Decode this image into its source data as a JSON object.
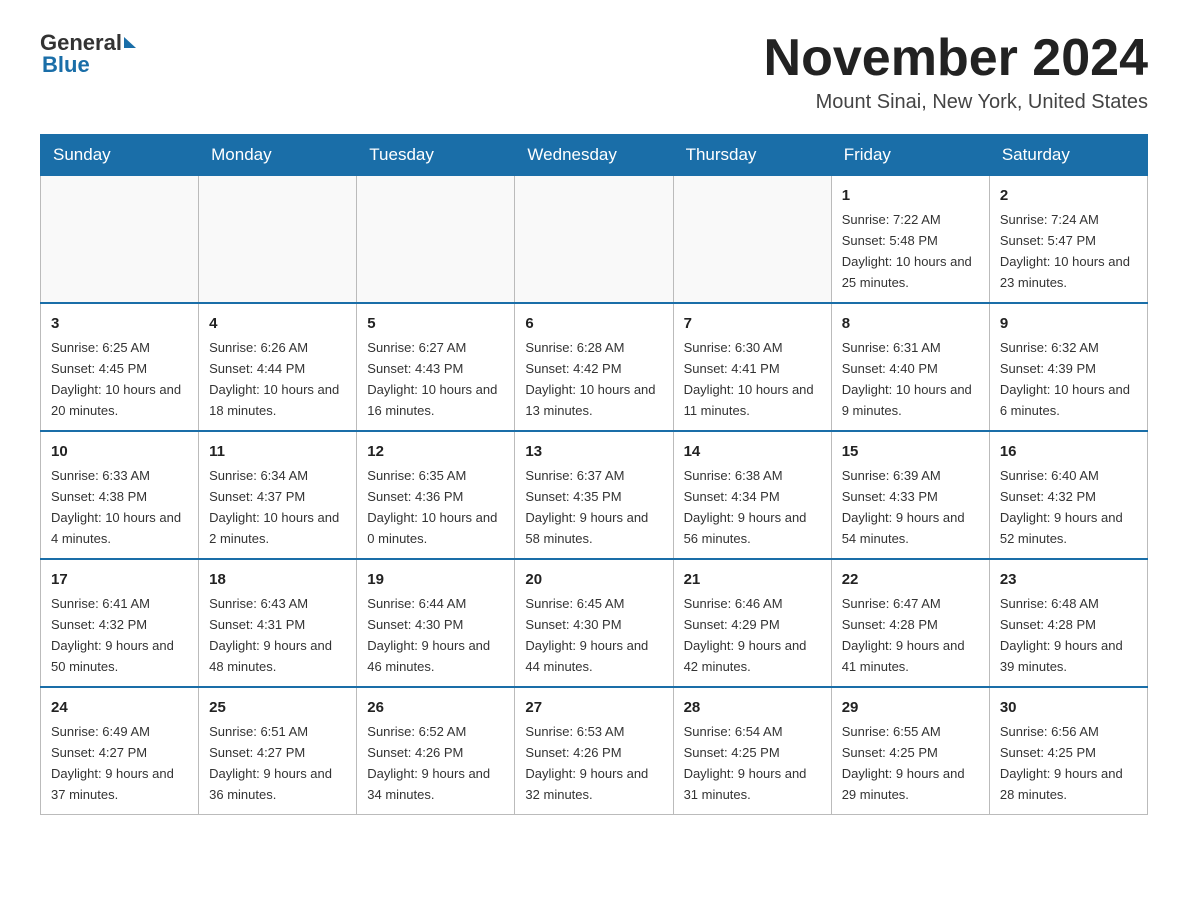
{
  "header": {
    "logo_general": "General",
    "logo_blue": "Blue",
    "month_title": "November 2024",
    "location": "Mount Sinai, New York, United States"
  },
  "weekdays": [
    "Sunday",
    "Monday",
    "Tuesday",
    "Wednesday",
    "Thursday",
    "Friday",
    "Saturday"
  ],
  "weeks": [
    [
      {
        "day": "",
        "sunrise": "",
        "sunset": "",
        "daylight": ""
      },
      {
        "day": "",
        "sunrise": "",
        "sunset": "",
        "daylight": ""
      },
      {
        "day": "",
        "sunrise": "",
        "sunset": "",
        "daylight": ""
      },
      {
        "day": "",
        "sunrise": "",
        "sunset": "",
        "daylight": ""
      },
      {
        "day": "",
        "sunrise": "",
        "sunset": "",
        "daylight": ""
      },
      {
        "day": "1",
        "sunrise": "Sunrise: 7:22 AM",
        "sunset": "Sunset: 5:48 PM",
        "daylight": "Daylight: 10 hours and 25 minutes."
      },
      {
        "day": "2",
        "sunrise": "Sunrise: 7:24 AM",
        "sunset": "Sunset: 5:47 PM",
        "daylight": "Daylight: 10 hours and 23 minutes."
      }
    ],
    [
      {
        "day": "3",
        "sunrise": "Sunrise: 6:25 AM",
        "sunset": "Sunset: 4:45 PM",
        "daylight": "Daylight: 10 hours and 20 minutes."
      },
      {
        "day": "4",
        "sunrise": "Sunrise: 6:26 AM",
        "sunset": "Sunset: 4:44 PM",
        "daylight": "Daylight: 10 hours and 18 minutes."
      },
      {
        "day": "5",
        "sunrise": "Sunrise: 6:27 AM",
        "sunset": "Sunset: 4:43 PM",
        "daylight": "Daylight: 10 hours and 16 minutes."
      },
      {
        "day": "6",
        "sunrise": "Sunrise: 6:28 AM",
        "sunset": "Sunset: 4:42 PM",
        "daylight": "Daylight: 10 hours and 13 minutes."
      },
      {
        "day": "7",
        "sunrise": "Sunrise: 6:30 AM",
        "sunset": "Sunset: 4:41 PM",
        "daylight": "Daylight: 10 hours and 11 minutes."
      },
      {
        "day": "8",
        "sunrise": "Sunrise: 6:31 AM",
        "sunset": "Sunset: 4:40 PM",
        "daylight": "Daylight: 10 hours and 9 minutes."
      },
      {
        "day": "9",
        "sunrise": "Sunrise: 6:32 AM",
        "sunset": "Sunset: 4:39 PM",
        "daylight": "Daylight: 10 hours and 6 minutes."
      }
    ],
    [
      {
        "day": "10",
        "sunrise": "Sunrise: 6:33 AM",
        "sunset": "Sunset: 4:38 PM",
        "daylight": "Daylight: 10 hours and 4 minutes."
      },
      {
        "day": "11",
        "sunrise": "Sunrise: 6:34 AM",
        "sunset": "Sunset: 4:37 PM",
        "daylight": "Daylight: 10 hours and 2 minutes."
      },
      {
        "day": "12",
        "sunrise": "Sunrise: 6:35 AM",
        "sunset": "Sunset: 4:36 PM",
        "daylight": "Daylight: 10 hours and 0 minutes."
      },
      {
        "day": "13",
        "sunrise": "Sunrise: 6:37 AM",
        "sunset": "Sunset: 4:35 PM",
        "daylight": "Daylight: 9 hours and 58 minutes."
      },
      {
        "day": "14",
        "sunrise": "Sunrise: 6:38 AM",
        "sunset": "Sunset: 4:34 PM",
        "daylight": "Daylight: 9 hours and 56 minutes."
      },
      {
        "day": "15",
        "sunrise": "Sunrise: 6:39 AM",
        "sunset": "Sunset: 4:33 PM",
        "daylight": "Daylight: 9 hours and 54 minutes."
      },
      {
        "day": "16",
        "sunrise": "Sunrise: 6:40 AM",
        "sunset": "Sunset: 4:32 PM",
        "daylight": "Daylight: 9 hours and 52 minutes."
      }
    ],
    [
      {
        "day": "17",
        "sunrise": "Sunrise: 6:41 AM",
        "sunset": "Sunset: 4:32 PM",
        "daylight": "Daylight: 9 hours and 50 minutes."
      },
      {
        "day": "18",
        "sunrise": "Sunrise: 6:43 AM",
        "sunset": "Sunset: 4:31 PM",
        "daylight": "Daylight: 9 hours and 48 minutes."
      },
      {
        "day": "19",
        "sunrise": "Sunrise: 6:44 AM",
        "sunset": "Sunset: 4:30 PM",
        "daylight": "Daylight: 9 hours and 46 minutes."
      },
      {
        "day": "20",
        "sunrise": "Sunrise: 6:45 AM",
        "sunset": "Sunset: 4:30 PM",
        "daylight": "Daylight: 9 hours and 44 minutes."
      },
      {
        "day": "21",
        "sunrise": "Sunrise: 6:46 AM",
        "sunset": "Sunset: 4:29 PM",
        "daylight": "Daylight: 9 hours and 42 minutes."
      },
      {
        "day": "22",
        "sunrise": "Sunrise: 6:47 AM",
        "sunset": "Sunset: 4:28 PM",
        "daylight": "Daylight: 9 hours and 41 minutes."
      },
      {
        "day": "23",
        "sunrise": "Sunrise: 6:48 AM",
        "sunset": "Sunset: 4:28 PM",
        "daylight": "Daylight: 9 hours and 39 minutes."
      }
    ],
    [
      {
        "day": "24",
        "sunrise": "Sunrise: 6:49 AM",
        "sunset": "Sunset: 4:27 PM",
        "daylight": "Daylight: 9 hours and 37 minutes."
      },
      {
        "day": "25",
        "sunrise": "Sunrise: 6:51 AM",
        "sunset": "Sunset: 4:27 PM",
        "daylight": "Daylight: 9 hours and 36 minutes."
      },
      {
        "day": "26",
        "sunrise": "Sunrise: 6:52 AM",
        "sunset": "Sunset: 4:26 PM",
        "daylight": "Daylight: 9 hours and 34 minutes."
      },
      {
        "day": "27",
        "sunrise": "Sunrise: 6:53 AM",
        "sunset": "Sunset: 4:26 PM",
        "daylight": "Daylight: 9 hours and 32 minutes."
      },
      {
        "day": "28",
        "sunrise": "Sunrise: 6:54 AM",
        "sunset": "Sunset: 4:25 PM",
        "daylight": "Daylight: 9 hours and 31 minutes."
      },
      {
        "day": "29",
        "sunrise": "Sunrise: 6:55 AM",
        "sunset": "Sunset: 4:25 PM",
        "daylight": "Daylight: 9 hours and 29 minutes."
      },
      {
        "day": "30",
        "sunrise": "Sunrise: 6:56 AM",
        "sunset": "Sunset: 4:25 PM",
        "daylight": "Daylight: 9 hours and 28 minutes."
      }
    ]
  ]
}
